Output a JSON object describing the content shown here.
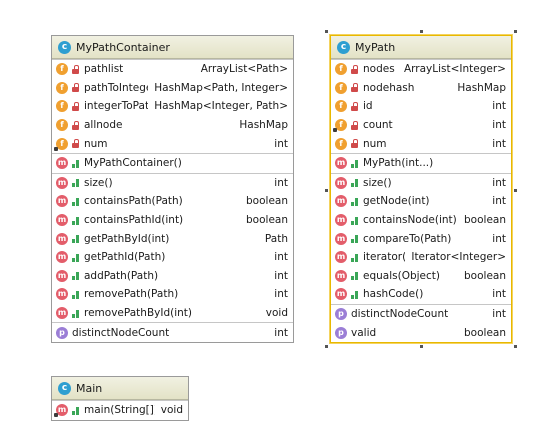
{
  "diagram": {
    "classes": [
      {
        "id": "mypathcontainer",
        "title": "MyPathContainer",
        "sections": [
          [
            {
              "kind": "field",
              "access": "private",
              "name": "pathlist",
              "type": "ArrayList<Path>"
            },
            {
              "kind": "field",
              "access": "private",
              "name": "pathToInteger",
              "type": "HashMap<Path, Integer>"
            },
            {
              "kind": "field",
              "access": "private",
              "name": "integerToPath",
              "type": "HashMap<Integer, Path>"
            },
            {
              "kind": "field",
              "access": "private",
              "name": "allnode",
              "type": "HashMap"
            },
            {
              "kind": "field",
              "access": "private",
              "static": true,
              "name": "num",
              "type": "int"
            }
          ],
          [
            {
              "kind": "method",
              "access": "public",
              "name": "MyPathContainer()",
              "type": ""
            }
          ],
          [
            {
              "kind": "method",
              "access": "public",
              "name": "size()",
              "type": "int"
            },
            {
              "kind": "method",
              "access": "public",
              "name": "containsPath(Path)",
              "type": "boolean"
            },
            {
              "kind": "method",
              "access": "public",
              "name": "containsPathId(int)",
              "type": "boolean"
            },
            {
              "kind": "method",
              "access": "public",
              "name": "getPathById(int)",
              "type": "Path"
            },
            {
              "kind": "method",
              "access": "public",
              "name": "getPathId(Path)",
              "type": "int"
            },
            {
              "kind": "method",
              "access": "public",
              "name": "addPath(Path)",
              "type": "int"
            },
            {
              "kind": "method",
              "access": "public",
              "name": "removePath(Path)",
              "type": "int"
            },
            {
              "kind": "method",
              "access": "public",
              "name": "removePathById(int)",
              "type": "void"
            }
          ],
          [
            {
              "kind": "property",
              "access": "none",
              "name": "distinctNodeCount",
              "type": "int"
            }
          ]
        ]
      },
      {
        "id": "mypath",
        "title": "MyPath",
        "selected": true,
        "sections": [
          [
            {
              "kind": "field",
              "access": "private",
              "name": "nodes",
              "type": "ArrayList<Integer>"
            },
            {
              "kind": "field",
              "access": "private",
              "name": "nodehash",
              "type": "HashMap"
            },
            {
              "kind": "field",
              "access": "private",
              "name": "id",
              "type": "int"
            },
            {
              "kind": "field",
              "access": "private",
              "static": true,
              "name": "count",
              "type": "int"
            },
            {
              "kind": "field",
              "access": "private",
              "name": "num",
              "type": "int"
            }
          ],
          [
            {
              "kind": "method",
              "access": "public",
              "name": "MyPath(int...)",
              "type": ""
            }
          ],
          [
            {
              "kind": "method",
              "access": "public",
              "name": "size()",
              "type": "int"
            },
            {
              "kind": "method",
              "access": "public",
              "name": "getNode(int)",
              "type": "int"
            },
            {
              "kind": "method",
              "access": "public",
              "name": "containsNode(int)",
              "type": "boolean"
            },
            {
              "kind": "method",
              "access": "public",
              "name": "compareTo(Path)",
              "type": "int"
            },
            {
              "kind": "method",
              "access": "public",
              "name": "iterator()",
              "type": "Iterator<Integer>"
            },
            {
              "kind": "method",
              "access": "public",
              "name": "equals(Object)",
              "type": "boolean"
            },
            {
              "kind": "method",
              "access": "public",
              "name": "hashCode()",
              "type": "int"
            }
          ],
          [
            {
              "kind": "property",
              "access": "none",
              "name": "distinctNodeCount",
              "type": "int"
            },
            {
              "kind": "property",
              "access": "none",
              "name": "valid",
              "type": "boolean"
            }
          ]
        ]
      },
      {
        "id": "main",
        "title": "Main",
        "sections": [
          [
            {
              "kind": "method",
              "access": "public",
              "static": true,
              "name": "main(String[])",
              "type": "void"
            }
          ]
        ]
      }
    ],
    "badges": {
      "class": "c",
      "field": "f",
      "method": "m",
      "property": "p"
    },
    "colors": {
      "class_badge": "#2e9fd1",
      "field_badge": "#f0a030",
      "method_badge": "#e35d6a",
      "property_badge": "#9b7ed6",
      "selection_border": "#e8b800"
    }
  }
}
